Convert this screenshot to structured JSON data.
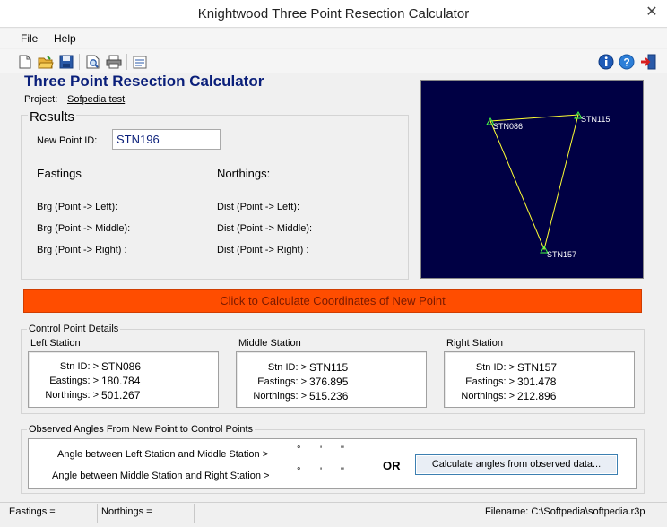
{
  "window": {
    "title": "Knightwood Three Point Resection Calculator",
    "close_glyph": "✕"
  },
  "menu": {
    "file": "File",
    "help": "Help"
  },
  "toolbar_icons": [
    "new-icon",
    "open-folder-icon",
    "save-icon",
    "print-preview-icon",
    "print-icon",
    "list-icon",
    "info-icon",
    "help-icon",
    "exit-icon"
  ],
  "colors": {
    "accent_button": "#ff4d00",
    "heading": "#0a1f7a",
    "map_bg": "#000044",
    "map_line": "#ffff33"
  },
  "app": {
    "heading": "Three Point Resection Calculator",
    "project_label": "Project:",
    "project_name": "Sofpedia test"
  },
  "results": {
    "title": "Results",
    "new_point_label": "New Point ID:",
    "new_point_value": "STN196",
    "eastings_head": "Eastings",
    "northings_head": "Northings:",
    "brg_left": "Brg (Point -> Left):",
    "brg_middle": "Brg (Point -> Middle):",
    "brg_right": "Brg (Point -> Right) :",
    "dist_left": "Dist (Point -> Left):",
    "dist_middle": "Dist (Point -> Middle):",
    "dist_right": "Dist (Point -> Right) :"
  },
  "map": {
    "labels": {
      "stn086": "STN086",
      "stn115": "STN115",
      "stn157": "STN157"
    }
  },
  "calc_button": "Click to Calculate Coordinates of New Point",
  "control": {
    "title": "Control Point Details",
    "left": {
      "title": "Left Station",
      "id_label": "Stn ID: >",
      "id": "STN086",
      "e_label": "Eastings: >",
      "e": "180.784",
      "n_label": "Northings: >",
      "n": "501.267"
    },
    "middle": {
      "title": "Middle Station",
      "id_label": "Stn ID: >",
      "id": "STN115",
      "e_label": "Eastings: >",
      "e": "376.895",
      "n_label": "Northings: >",
      "n": "515.236"
    },
    "right": {
      "title": "Right Station",
      "id_label": "Stn ID: >",
      "id": "STN157",
      "e_label": "Eastings: >",
      "e": "301.478",
      "n_label": "Northings: >",
      "n": "212.896"
    }
  },
  "angles": {
    "title": "Observed Angles From New Point to Control Points",
    "left_middle": "Angle between Left Station and Middle Station >",
    "middle_right": "Angle between Middle Station and Right Station >",
    "deg_mark": "°",
    "min_mark": "'",
    "sec_mark": "\"",
    "or_text": "OR",
    "observed_button": "Calculate angles from observed data..."
  },
  "status": {
    "eastings": "Eastings =",
    "northings": "Northings =",
    "filename": "Filename:  C:\\Softpedia\\softpedia.r3p"
  }
}
